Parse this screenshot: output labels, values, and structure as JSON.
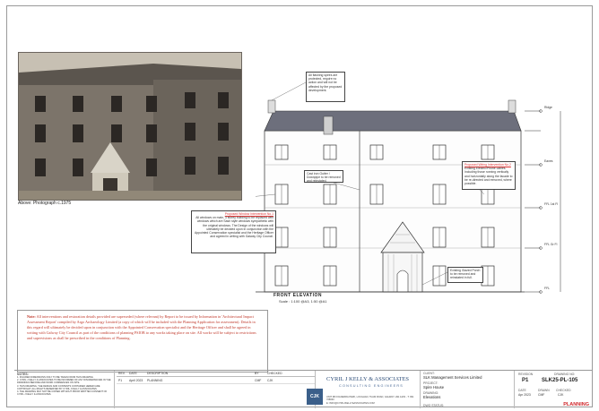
{
  "photo": {
    "caption": "Above: Photograph c.1975"
  },
  "note": {
    "label": "Note:",
    "text": "All interventions and restoration details provided are superseded (where relevant) by Report to be issued by Information in 'Architectural Impact Assessment Report' compiled by Argo Archaeology Limited (a copy of which will be included with the Planning Application for assessment). Details in this regard will ultimately be decided upon in conjunction with the Appointed Conservation specialist and the Heritage Officer and shall be agreed in writing with Galway City Council as part of the conditions of planning PSIOB to any works taking place on site. All works will be subject to restrictions and supervisions as shall be prescribed in the conditions of Planning."
  },
  "elevation": {
    "title": "FRONT ELEVATION",
    "scale": "Scale : 1:100 @A3, 1:50 @A1",
    "levels": [
      "Ridge",
      "Eaves",
      "FFL 1st Fl",
      "FFL Gr Fl",
      "FFL"
    ],
    "callouts": {
      "top": "All flashing spires are protected, require no action and will not be affected by the proposed development.",
      "mid_left_heading": "Proposed Window Intervention No.1",
      "mid_left": "All windows on main, 3 storey building to be replaced with windows which are Sash style windows sympathetic with the original windows. The Design of the windows will ultimately be decided upon in conjunction with the Appointed Conservation specialist and the Heritage Officer and agreed in writing with Galway City Council.",
      "center": "Cast iron Gutter / Downpipe to be removed and reinstated.",
      "right_heading": "Proposed Wiring Intervention No.2",
      "right": "Existing Electric/Phone cables. Including those running vertically and horizontally along the facade to be re-directed and removed, where possible.",
      "bottom": "Existing Glazed Porch to be removed and reinstated in full."
    }
  },
  "notes_col": {
    "title": "NOTES:",
    "items": [
      "1. FIGURED DIMENSIONS ONLY TO BE TAKEN FROM THIS DRAWING",
      "2. CYRIL J KELLY & ASSOCIATES TO BE INFORMED OF ANY DISCREPANCIES IN THE DRAWINGS BEFORE AND WORK COMMENCES ON SITE.",
      "3. THIS DRAWING, THE DESIGN AND CONTENTS CONTAINED HEREIN ARE COPYRIGHT. ALL RIGHTS RESERVED BY CYRIL J KELLY & ASSOCIATES.",
      "4. THE DRAWING MAY NOT BE COPIED WITHOUT PRIOR WRITTEN CONSENT OF CYRIL J KELLY & ASSOCIATES."
    ]
  },
  "revisions": {
    "headers": [
      "REV.",
      "DATE",
      "DESCRIPTION",
      "BY",
      "CHECKED"
    ],
    "rows": [
      [
        "P1",
        "April 2023",
        "PLANNING",
        "CMF",
        "CJK"
      ]
    ]
  },
  "firm": {
    "name": "CYRIL J KELLY & ASSOCIATES",
    "sub": "CONSULTING ENGINEERS",
    "address": "UNIT 3B FOLDERRA PARK, LOUGHAN, TUAM ROAD, GALWAY. H91 A1F9 - T: 091 768630",
    "email": "E: INFO@CYRILJKELLY&ASSOCIATES.COM",
    "logo": "CJK"
  },
  "client": {
    "client_label": "CLIENT:",
    "client": "SLK Management Services Limited",
    "project_label": "PROJECT:",
    "project": "Spire House",
    "drawing_label": "DRAWING:",
    "drawing": "Elevations",
    "status_label": "DWG STATUS:"
  },
  "meta": {
    "revision_label": "REVISION",
    "revision": "P1",
    "drawing_no_label": "DRAWING NO:",
    "drawing_no": "SLK25-PL-105",
    "date_label": "DATE",
    "date": "Apr 2023",
    "drawn_label": "DRAWN",
    "drawn": "CMF",
    "checked_label": "CHECKED",
    "checked": "CJK",
    "status": "PLANNING"
  },
  "colors": {
    "status": "#d0262a",
    "note": "#c0392b",
    "roof": "#6d6f7c"
  }
}
